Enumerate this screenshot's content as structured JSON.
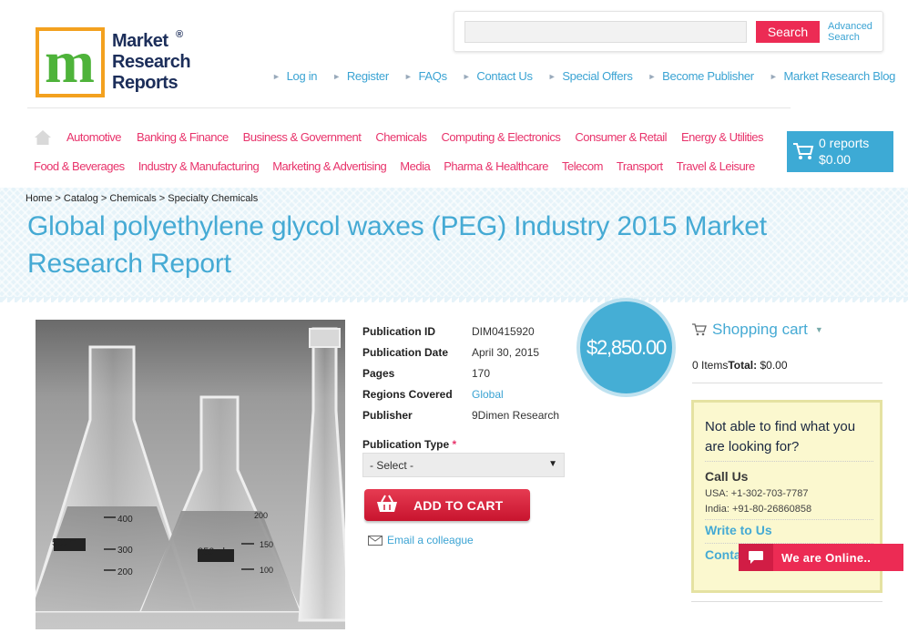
{
  "logo": {
    "line1": "Market",
    "line2": "Research",
    "line3": "Reports",
    "reg": "®",
    "mark_letter": "m"
  },
  "search": {
    "placeholder": "",
    "button": "Search",
    "advanced_line1": "Advanced",
    "advanced_line2": "Search"
  },
  "top_links": [
    "Log in",
    "Register",
    "FAQs",
    "Contact Us",
    "Special Offers",
    "Become Publisher",
    "Market Research Blog"
  ],
  "categories_row1": [
    "Automotive",
    "Banking & Finance",
    "Business & Government",
    "Chemicals",
    "Computing & Electronics",
    "Consumer & Retail",
    "Energy & Utilities"
  ],
  "categories_row2": [
    "Food & Beverages",
    "Industry & Manufacturing",
    "Marketing & Advertising",
    "Media",
    "Pharma & Healthcare",
    "Telecom",
    "Transport",
    "Travel & Leisure"
  ],
  "cart": {
    "reports": "0 reports",
    "price": "$0.00"
  },
  "breadcrumb": [
    "Home",
    "Catalog",
    "Chemicals",
    "Specialty Chemicals"
  ],
  "title": "Global polyethylene glycol waxes (PEG) Industry 2015 Market Research Report",
  "details": [
    {
      "label": "Publication ID",
      "value": "DIM0415920"
    },
    {
      "label": "Publication Date",
      "value": "April 30, 2015"
    },
    {
      "label": "Pages",
      "value": "170"
    },
    {
      "label": "Regions Covered",
      "value": "Global"
    },
    {
      "label": "Publisher",
      "value": "9Dimen Research"
    }
  ],
  "publication_type": {
    "label": "Publication Type",
    "required": "*",
    "selected": "- Select -"
  },
  "add_to_cart": "ADD TO CART",
  "email_colleague": "Email a colleague",
  "price": "$2,850.00",
  "shopping_cart": {
    "title": "Shopping cart",
    "items": "0 Items",
    "total_label": "Total:",
    "total_value": "$0.00"
  },
  "help": {
    "title": "Not able to find what you are looking for?",
    "call_us": "Call Us",
    "usa": "USA: +1-302-703-7787",
    "india": "India: +91-80-26860858",
    "write": "Write to Us",
    "contact": "Contact Market Research"
  },
  "chat": "We are Online..",
  "colors": {
    "accent_blue": "#45aad4",
    "accent_pink": "#e8336b",
    "search_red": "#ec2b54",
    "logo_orange": "#f3a11f"
  },
  "image_photo": "laboratory glassware: flasks with 500ml and 250ml markings (grayscale)"
}
